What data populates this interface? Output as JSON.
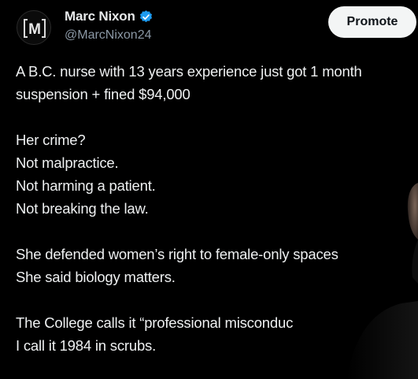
{
  "author": {
    "name": "Marc Nixon",
    "handle": "@MarcNixon24",
    "avatar_letter": "M",
    "verified_icon": "verified-badge-icon",
    "verified_color": "#1d9bf0"
  },
  "actions": {
    "promote_label": "Promote"
  },
  "post": {
    "paragraphs": [
      {
        "lines": [
          "A B.C. nurse with 13 years experience just got 1 month",
          "suspension + fined $94,000"
        ]
      },
      {
        "lines": [
          "Her crime?",
          "Not malpractice.",
          "Not harming a patient.",
          "Not breaking the law."
        ]
      },
      {
        "lines": [
          "She defended women’s right to female-only spaces",
          "She said biology matters."
        ]
      },
      {
        "lines": [
          "The College calls it “professional misconduc",
          "I call it 1984 in scrubs."
        ]
      }
    ]
  },
  "colors": {
    "background": "#000000",
    "text": "#e7e9ea",
    "secondary_text": "#8b98a5",
    "promote_bg": "#f3f5f5"
  }
}
